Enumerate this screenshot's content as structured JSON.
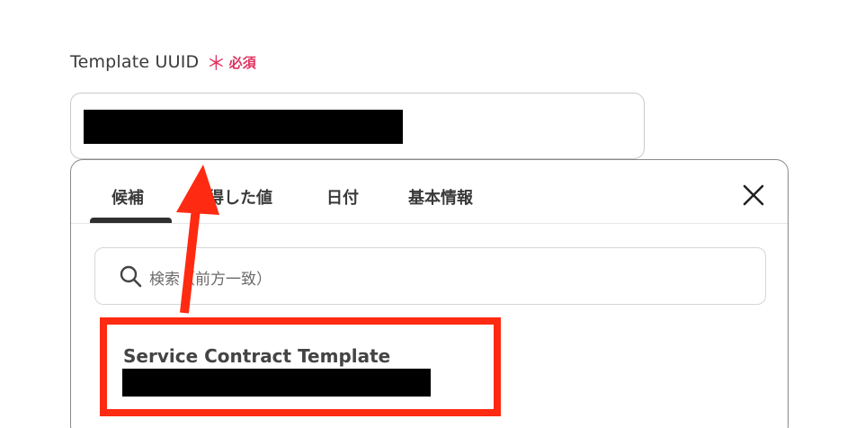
{
  "field": {
    "label": "Template UUID",
    "required_mark": "＊",
    "required_text": "必須"
  },
  "tabs": [
    {
      "label": "候補",
      "active": true
    },
    {
      "label": "得した値",
      "active": false
    },
    {
      "label": "日付",
      "active": false
    },
    {
      "label": "基本情報",
      "active": false
    }
  ],
  "search": {
    "placeholder": "検索（前方一致）"
  },
  "options": [
    {
      "title": "Service Contract Template"
    }
  ],
  "colors": {
    "required": "#e0315f",
    "annotation": "#ff2a12"
  },
  "icons": {
    "close": "close-icon",
    "search": "search-icon"
  }
}
